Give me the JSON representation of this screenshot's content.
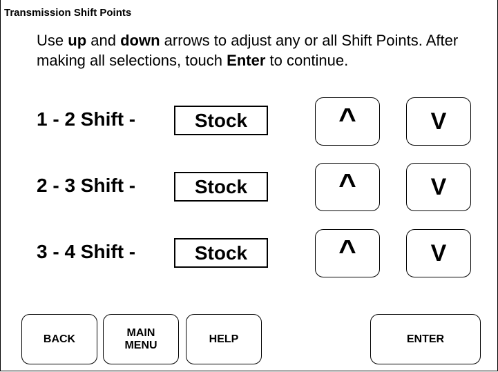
{
  "screen": {
    "title": "Transmission Shift Points"
  },
  "instructions": {
    "part1": "Use ",
    "up_word": "up",
    "part2": " and ",
    "down_word": "down",
    "part3": " arrows to adjust any or all Shift Points. After making all selections, touch ",
    "enter_word": "Enter",
    "part4": " to continue."
  },
  "shift_rows": [
    {
      "label": "1 - 2 Shift -",
      "value": "Stock",
      "up_label": "^",
      "down_label": "V"
    },
    {
      "label": "2 - 3 Shift -",
      "value": "Stock",
      "up_label": "^",
      "down_label": "V"
    },
    {
      "label": "3 - 4 Shift -",
      "value": "Stock",
      "up_label": "^",
      "down_label": "V"
    }
  ],
  "nav": {
    "back_label": "BACK",
    "main_menu_label": "MAIN\nMENU",
    "help_label": "HELP",
    "enter_label": "ENTER"
  }
}
